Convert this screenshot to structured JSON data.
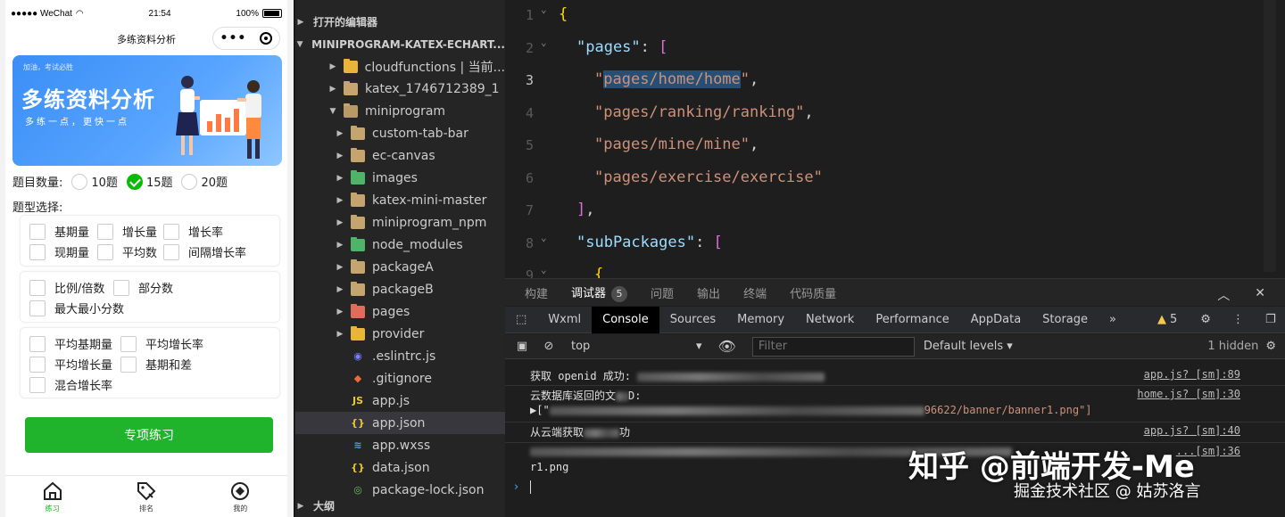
{
  "phone": {
    "status": {
      "signal": "●●●●● WeChat",
      "time": "21:54",
      "battery": "100%"
    },
    "nav_title": "多练资料分析",
    "capsule_dots": "•••",
    "banner": {
      "tag": "加油，考试必胜",
      "title": "多练资料分析",
      "subtitle": "多练一点，更快一点"
    },
    "count": {
      "label": "题目数量:",
      "options": [
        "10题",
        "15题",
        "20题"
      ],
      "selected": "15题"
    },
    "type_label": "题型选择:",
    "groups": [
      [
        "基期量",
        "增长量",
        "增长率",
        "现期量",
        "平均数",
        "间隔增长率"
      ],
      [
        "比例/倍数",
        "部分数",
        "最大最小分数"
      ],
      [
        "平均基期量",
        "平均增长率",
        "平均增长量",
        "基期和差",
        "混合增长率"
      ]
    ],
    "practice_button": "专项练习",
    "tabs": [
      "练习",
      "排名",
      "我的"
    ]
  },
  "explorer": {
    "open_editors": "打开的编辑器",
    "project": "MINIPROGRAM-KATEX-ECHART...",
    "items": [
      {
        "label": "cloudfunctions | 当前...",
        "type": "folder-yellow",
        "level": 1
      },
      {
        "label": "katex_1746712389_1",
        "type": "folder",
        "level": 1
      },
      {
        "label": "miniprogram",
        "type": "folder-open",
        "level": 1
      },
      {
        "label": "custom-tab-bar",
        "type": "folder",
        "level": 2
      },
      {
        "label": "ec-canvas",
        "type": "folder",
        "level": 2
      },
      {
        "label": "images",
        "type": "folder-green",
        "level": 2
      },
      {
        "label": "katex-mini-master",
        "type": "folder",
        "level": 2
      },
      {
        "label": "miniprogram_npm",
        "type": "folder",
        "level": 2
      },
      {
        "label": "node_modules",
        "type": "folder-green",
        "level": 2
      },
      {
        "label": "packageA",
        "type": "folder",
        "level": 2
      },
      {
        "label": "packageB",
        "type": "folder",
        "level": 2
      },
      {
        "label": "pages",
        "type": "folder-red",
        "level": 2
      },
      {
        "label": "provider",
        "type": "folder-yellow",
        "level": 2
      },
      {
        "label": ".eslintrc.js",
        "type": "file-eslint",
        "level": 2
      },
      {
        "label": ".gitignore",
        "type": "file-git",
        "level": 2
      },
      {
        "label": "app.js",
        "type": "file-js",
        "level": 2
      },
      {
        "label": "app.json",
        "type": "file-json",
        "level": 2,
        "selected": true
      },
      {
        "label": "app.wxss",
        "type": "file-wxss",
        "level": 2
      },
      {
        "label": "data.json",
        "type": "file-json",
        "level": 2
      },
      {
        "label": "package-lock.json",
        "type": "file-lock",
        "level": 2
      }
    ],
    "outline": "大纲"
  },
  "editor": {
    "line_numbers": [
      "1",
      "2",
      "3",
      "4",
      "5",
      "6",
      "7",
      "8",
      "9"
    ],
    "lines": [
      {
        "open": "{"
      },
      {
        "key": "\"pages\"",
        "sep": ": ",
        "open": "["
      },
      {
        "str": "\"pages/home/home\"",
        "tail": ","
      },
      {
        "str": "\"pages/ranking/ranking\"",
        "tail": ","
      },
      {
        "str": "\"pages/mine/mine\"",
        "tail": ","
      },
      {
        "str": "\"pages/exercise/exercise\"",
        "tail": ""
      },
      {
        "close": "]",
        "tail": ","
      },
      {
        "key": "\"subPackages\"",
        "sep": ": ",
        "open": "["
      },
      {
        "open": "{"
      }
    ]
  },
  "panel": {
    "tabs": [
      "构建",
      "调试器",
      "问题",
      "输出",
      "终端",
      "代码质量"
    ],
    "debugger_badge": "5",
    "devtools_tabs": [
      "Wxml",
      "Console",
      "Sources",
      "Memory",
      "Network",
      "Performance",
      "AppData",
      "Storage"
    ],
    "more": "»",
    "warn_count": "5",
    "context": "top",
    "filter_placeholder": "Filter",
    "levels": "Default levels",
    "hidden": "1 hidden",
    "logs": [
      {
        "msg": "获取 openid 成功:",
        "src": "app.js? [sm]:89"
      },
      {
        "msg": "云数据库返回的文",
        "msg_tail": "D:",
        "src": "home.js? [sm]:30"
      },
      {
        "msg": "▶[\"",
        "msg_tail": "96622/banner/banner1.png\"]",
        "src": ""
      },
      {
        "msg": "从云端获取",
        "msg_tail": "功",
        "src": "app.js? [sm]:40"
      },
      {
        "msg": "",
        "src": "...[sm]:36"
      },
      {
        "msg": "r1.png",
        "src": ""
      }
    ],
    "prompt": "›"
  },
  "watermark": {
    "line1": "知乎 @前端开发-Me",
    "line2": "掘金技术社区 @ 姑苏洛言"
  },
  "colors": {
    "accent_green": "#09bb07",
    "button_green": "#20b42c",
    "editor_bg": "#1e1e1e",
    "selection": "#264f78"
  }
}
